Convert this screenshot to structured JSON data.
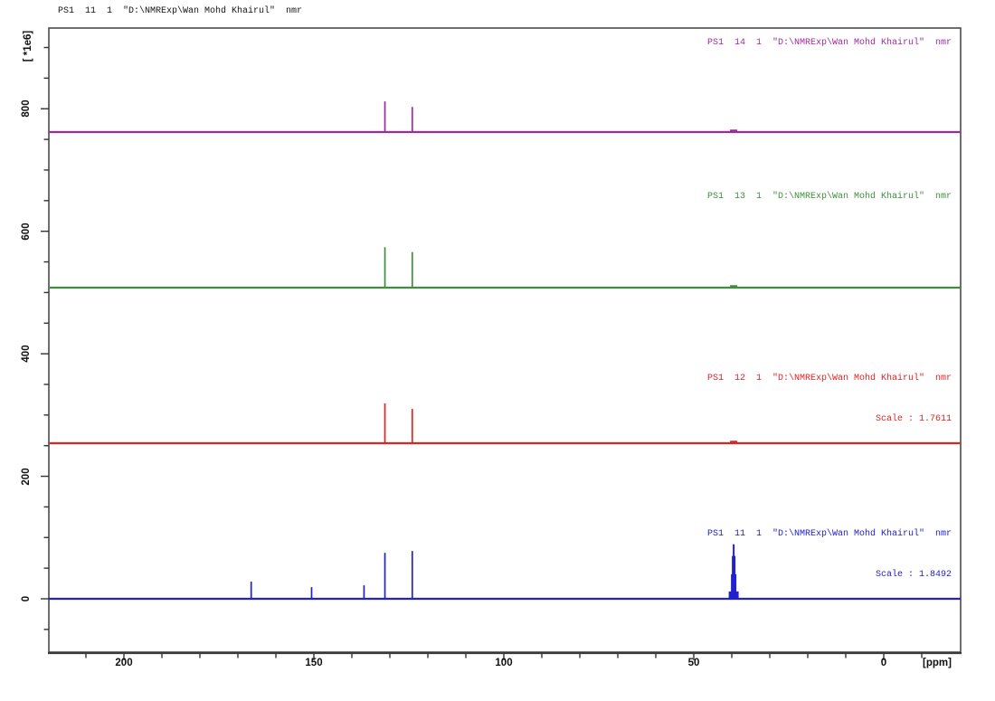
{
  "window_title": "PS1  11  1  \"D:\\NMRExp\\Wan Mohd Khairul\"  nmr",
  "axes": {
    "y_unit_label": "[ *1e6]",
    "x_unit_label": "[ppm]"
  },
  "chart_data": {
    "type": "line",
    "title": "Stacked 13C NMR multiple display, 4 spectra with vertical offsets",
    "xlabel": "[ppm]",
    "ylabel": "[ *1e6]",
    "x_range": [
      220,
      -20
    ],
    "x_ticks_major": [
      200,
      150,
      100,
      50,
      0
    ],
    "x_minor_step": 10,
    "y_range": [
      -87,
      932
    ],
    "y_ticks_major": [
      800,
      600,
      400,
      200,
      0
    ],
    "y_minor_step": 50,
    "grid": "off",
    "legend_position": "in-plot right, one label per trace",
    "series": [
      {
        "name": "PS1 11 1",
        "label": "PS1  11  1  \"D:\\NMRExp\\Wan Mohd Khairul\"  nmr",
        "scale_label": "Scale : 1.8492",
        "color": "#2121cd",
        "baseline": 0,
        "peaks": [
          {
            "ppm": 166.5,
            "i": 28
          },
          {
            "ppm": 150.6,
            "i": 19
          },
          {
            "ppm": 136.8,
            "i": 22
          },
          {
            "ppm": 131.3,
            "i": 75
          },
          {
            "ppm": 124.1,
            "i": 78
          },
          {
            "ppm": 39.5,
            "i": 89,
            "w": 2
          },
          {
            "ppm": 39.5,
            "i": 70,
            "w": 4
          },
          {
            "ppm": 39.5,
            "i": 40,
            "w": 6
          },
          {
            "ppm": 39.5,
            "i": 12,
            "w": 11
          }
        ]
      },
      {
        "name": "PS1 12 1",
        "label": "PS1  12  1  \"D:\\NMRExp\\Wan Mohd Khairul\"  nmr",
        "scale_label": "Scale : 1.7611",
        "color": "#dd2424",
        "baseline": 254,
        "peaks": [
          {
            "ppm": 131.3,
            "i": 65
          },
          {
            "ppm": 124.1,
            "i": 56
          },
          {
            "ppm": 39.5,
            "i": 4,
            "w": 8
          }
        ]
      },
      {
        "name": "PS1 13 1",
        "label": "PS1  13  1  \"D:\\NMRExp\\Wan Mohd Khairul\"  nmr",
        "scale_label": "",
        "color": "#3f8e3f",
        "baseline": 508,
        "peaks": [
          {
            "ppm": 131.3,
            "i": 66
          },
          {
            "ppm": 124.1,
            "i": 58
          },
          {
            "ppm": 39.5,
            "i": 4,
            "w": 8
          }
        ]
      },
      {
        "name": "PS1 14 1",
        "label": "PS1  14  1  \"D:\\NMRExp\\Wan Mohd Khairul\"  nmr",
        "scale_label": "",
        "color": "#9b2d9b",
        "baseline": 762,
        "peaks": [
          {
            "ppm": 131.3,
            "i": 50
          },
          {
            "ppm": 124.1,
            "i": 41
          },
          {
            "ppm": 39.5,
            "i": 4,
            "w": 8
          }
        ]
      }
    ]
  }
}
